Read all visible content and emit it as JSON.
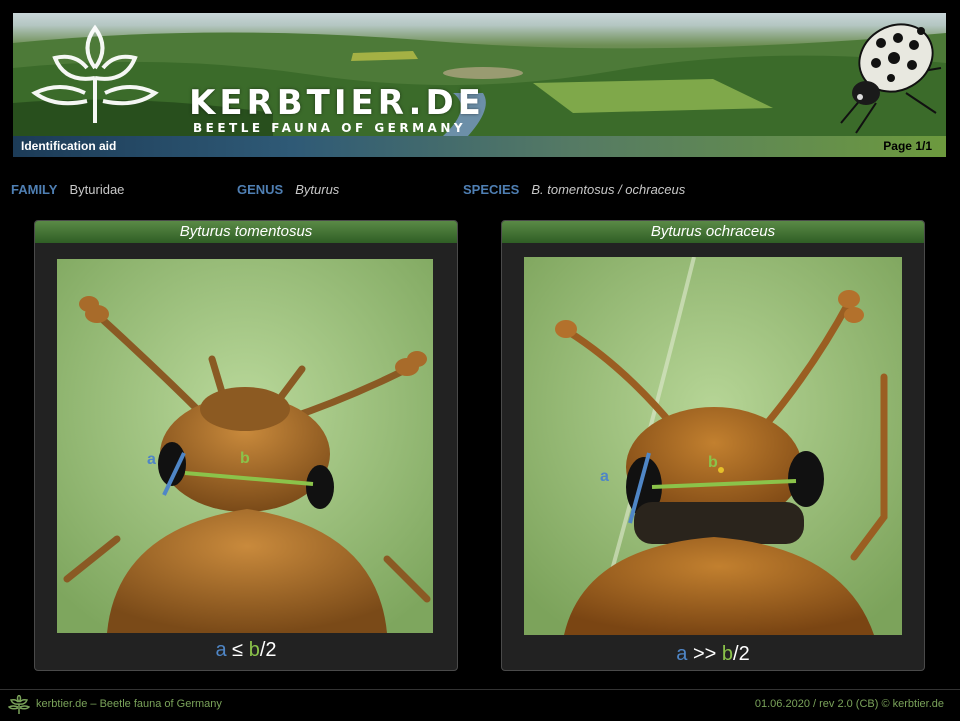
{
  "banner": {
    "logo_title": "KERBTIER.DE",
    "logo_subtitle": "BEETLE FAUNA OF GERMANY"
  },
  "bar": {
    "left_label": "Identification aid",
    "page_label": "Page 1/1"
  },
  "taxonomy": {
    "family_key": "FAMILY",
    "family_value": "Byturidae",
    "genus_key": "GENUS",
    "genus_value": "Byturus",
    "species_key": "SPECIES",
    "species_value": "B. tomentosus / ochraceus"
  },
  "panels": [
    {
      "title": "Byturus tomentosus",
      "label_a": "a",
      "label_b": "b",
      "formula_a": "a",
      "formula_op": " ≤ ",
      "formula_b": "b",
      "formula_tail": "/2"
    },
    {
      "title": "Byturus ochraceus",
      "label_a": "a",
      "label_b": "b",
      "formula_a": "a",
      "formula_op": " >> ",
      "formula_b": "b",
      "formula_tail": "/2"
    }
  ],
  "footer": {
    "left": "kerbtier.de – Beetle  fauna of Germany",
    "right": "01.06.2020 / rev 2.0 (CB) © kerbtier.de"
  },
  "colors": {
    "a_line": "#4f86c6",
    "b_line": "#8bc34a",
    "title_bar": "#3f6f30"
  },
  "icons": [
    "kerbtier-logo-icon",
    "beetle-banner-image"
  ]
}
